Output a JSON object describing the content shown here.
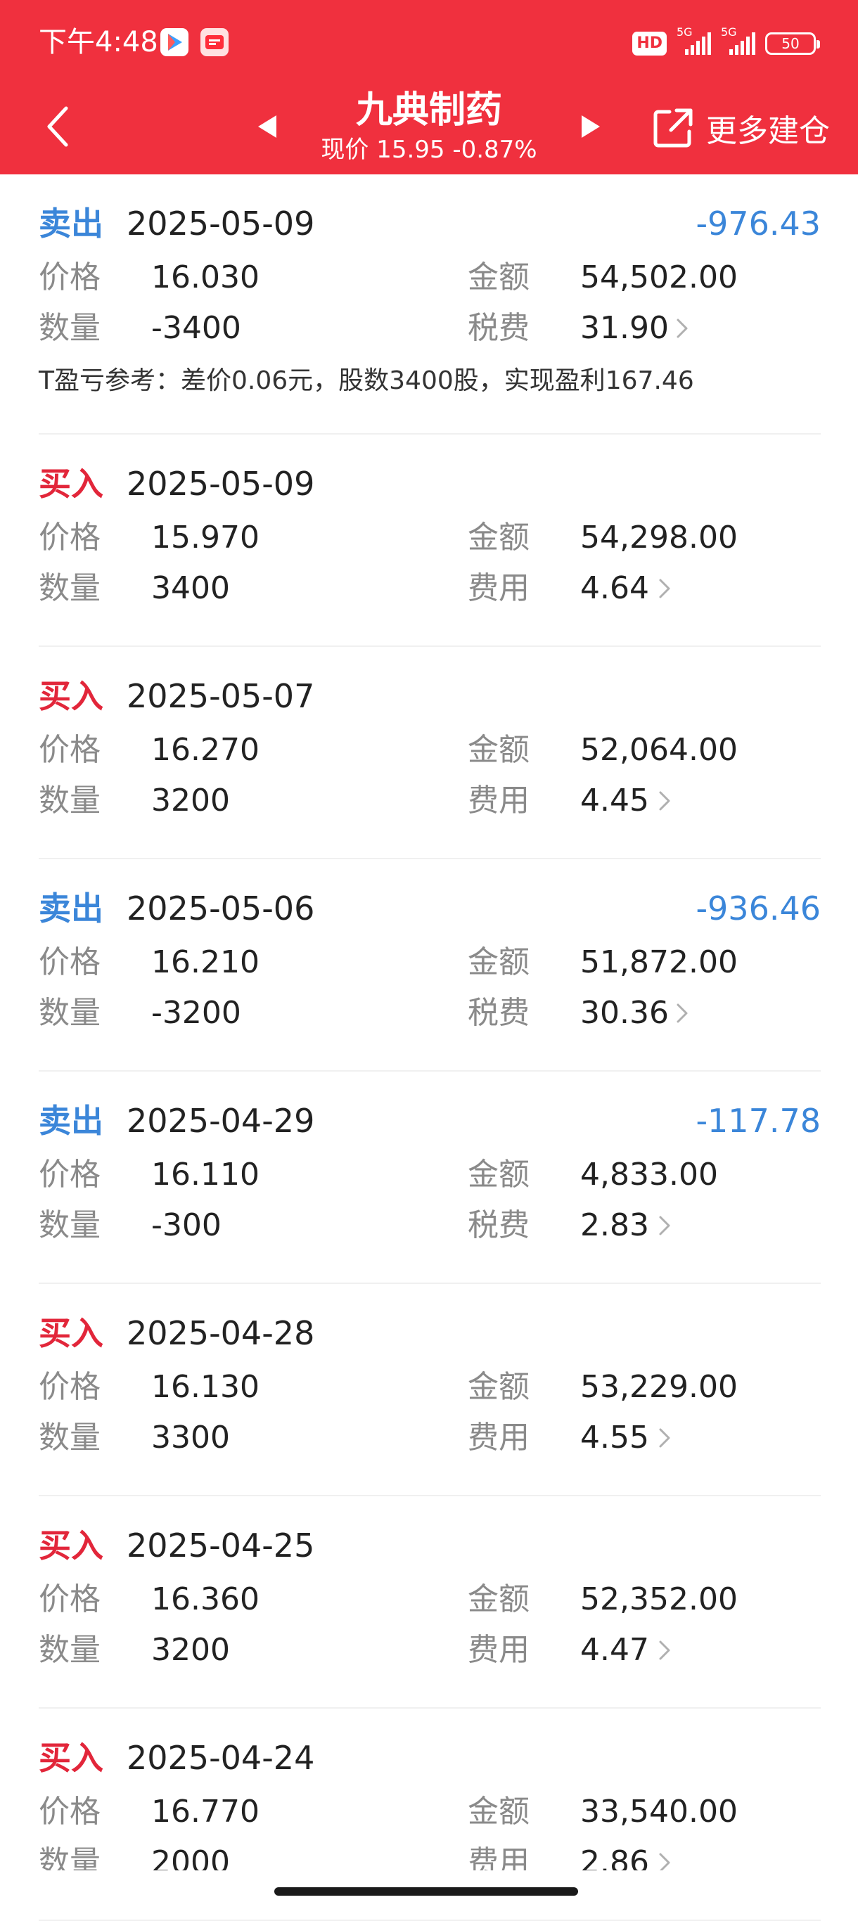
{
  "status": {
    "time": "下午4:48",
    "hd": "HD",
    "net1": "5G",
    "net2": "5G",
    "battery": "50"
  },
  "header": {
    "title": "九典制药",
    "subtitle": "现价 15.95 -0.87%",
    "more_label": "更多建仓"
  },
  "labels": {
    "price": "价格",
    "amount": "金额",
    "qty": "数量",
    "tax": "税费",
    "fee": "费用"
  },
  "records": [
    {
      "type": "卖出",
      "kind": "sell",
      "date": "2025-05-09",
      "pnl": "-976.43",
      "price": "16.030",
      "amount": "54,502.00",
      "qty": "-3400",
      "fee_label": "税费",
      "fee": "31.90",
      "note": "T盈亏参考：差价0.06元，股数3400股，实现盈利167.46"
    },
    {
      "type": "买入",
      "kind": "buy",
      "date": "2025-05-09",
      "pnl": "",
      "price": "15.970",
      "amount": "54,298.00",
      "qty": "3400",
      "fee_label": "费用",
      "fee": "4.64"
    },
    {
      "type": "买入",
      "kind": "buy",
      "date": "2025-05-07",
      "pnl": "",
      "price": "16.270",
      "amount": "52,064.00",
      "qty": "3200",
      "fee_label": "费用",
      "fee": "4.45"
    },
    {
      "type": "卖出",
      "kind": "sell",
      "date": "2025-05-06",
      "pnl": "-936.46",
      "price": "16.210",
      "amount": "51,872.00",
      "qty": "-3200",
      "fee_label": "税费",
      "fee": "30.36"
    },
    {
      "type": "卖出",
      "kind": "sell",
      "date": "2025-04-29",
      "pnl": "-117.78",
      "price": "16.110",
      "amount": "4,833.00",
      "qty": "-300",
      "fee_label": "税费",
      "fee": "2.83"
    },
    {
      "type": "买入",
      "kind": "buy",
      "date": "2025-04-28",
      "pnl": "",
      "price": "16.130",
      "amount": "53,229.00",
      "qty": "3300",
      "fee_label": "费用",
      "fee": "4.55"
    },
    {
      "type": "买入",
      "kind": "buy",
      "date": "2025-04-25",
      "pnl": "",
      "price": "16.360",
      "amount": "52,352.00",
      "qty": "3200",
      "fee_label": "费用",
      "fee": "4.47"
    },
    {
      "type": "买入",
      "kind": "buy",
      "date": "2025-04-24",
      "pnl": "",
      "price": "16.770",
      "amount": "33,540.00",
      "qty": "2000",
      "fee_label": "费用",
      "fee": "2.86"
    }
  ],
  "colors": {
    "header_bg": "#f0303e",
    "sell": "#3b86d9",
    "buy": "#e2263a"
  }
}
